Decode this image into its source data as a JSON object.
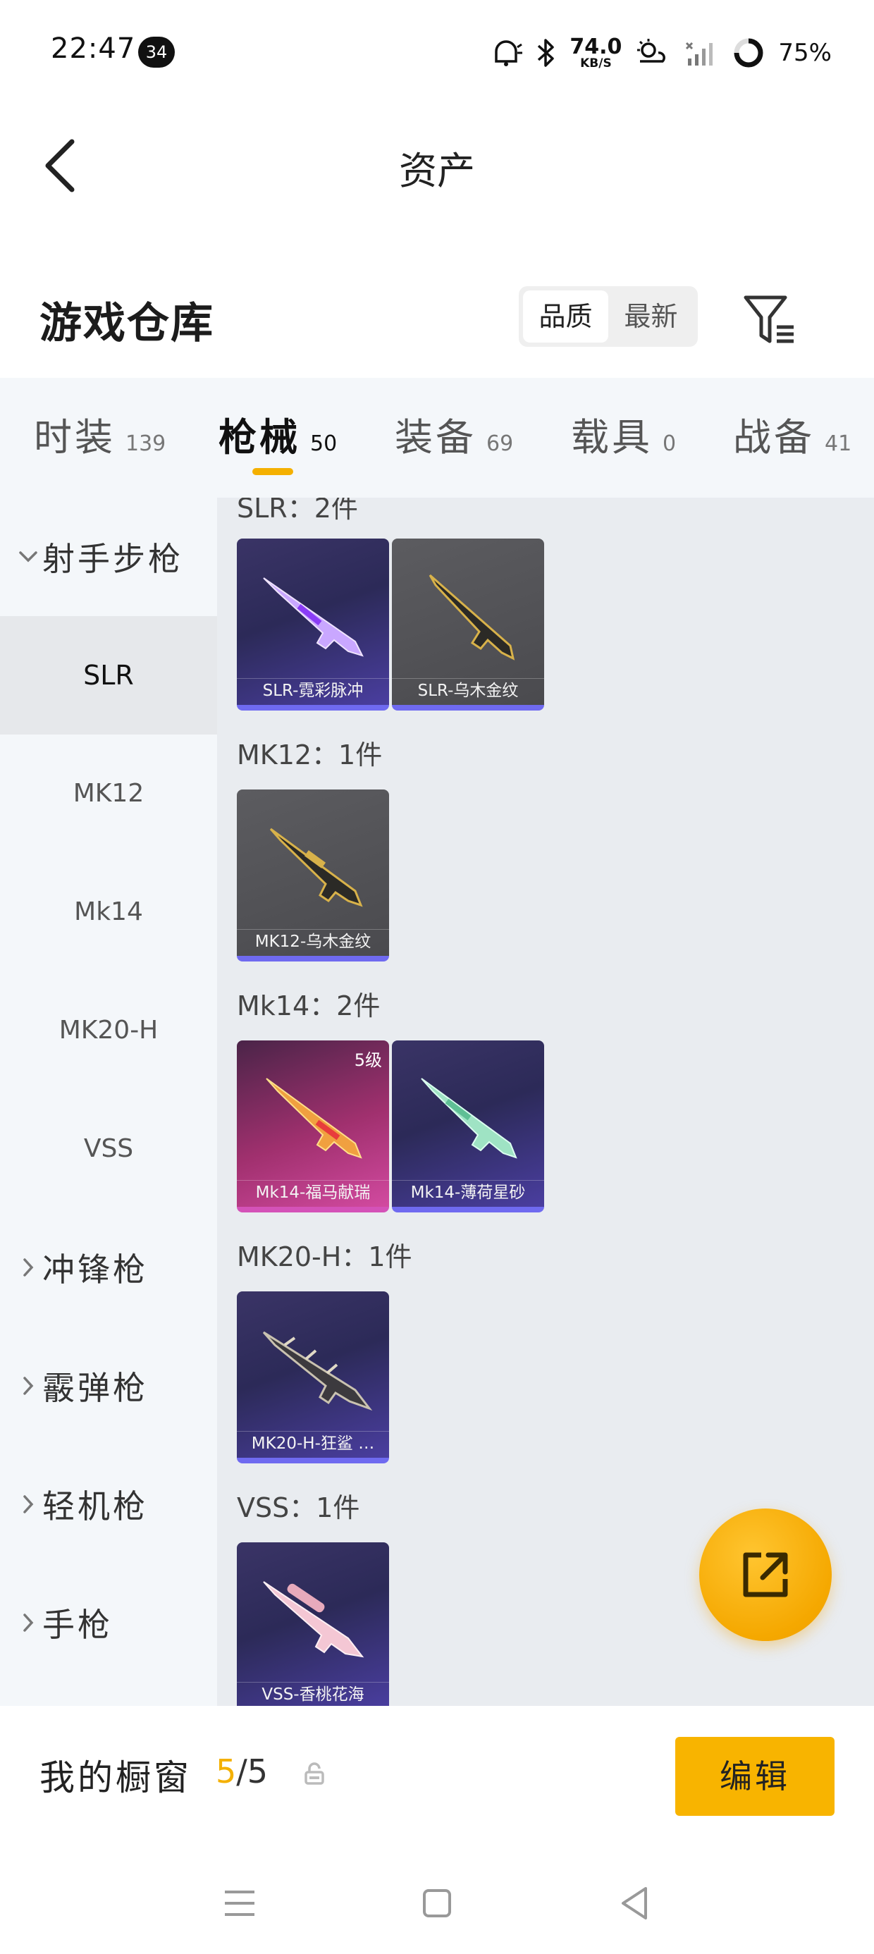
{
  "status_bar": {
    "time": "22:47",
    "notification_count": "34",
    "net_speed_value": "74.0",
    "net_speed_unit": "KB/S",
    "battery": "75%"
  },
  "header": {
    "title": "资产"
  },
  "warehouse": {
    "title": "游戏仓库",
    "sort_options": [
      "品质",
      "最新"
    ],
    "active_sort": "品质"
  },
  "tabs": [
    {
      "label": "时装",
      "count": "139"
    },
    {
      "label": "枪械",
      "count": "50"
    },
    {
      "label": "装备",
      "count": "69"
    },
    {
      "label": "载具",
      "count": "0"
    },
    {
      "label": "战备",
      "count": "41"
    }
  ],
  "active_tab": "枪械",
  "sidebar": {
    "expanded_category": "射手步枪",
    "subcategories": [
      "SLR",
      "MK12",
      "Mk14",
      "MK20-H",
      "VSS"
    ],
    "active_subcategory": "SLR",
    "collapsed_categories": [
      "冲锋枪",
      "霰弹枪",
      "轻机枪",
      "手枪"
    ]
  },
  "groups": [
    {
      "heading": "SLR：2件",
      "items": [
        {
          "name": "SLR-霓彩脉冲",
          "style": "purple",
          "level": ""
        },
        {
          "name": "SLR-乌木金纹",
          "style": "gray",
          "level": ""
        }
      ]
    },
    {
      "heading": "MK12：1件",
      "items": [
        {
          "name": "MK12-乌木金纹",
          "style": "gray",
          "level": ""
        }
      ]
    },
    {
      "heading": "Mk14：2件",
      "items": [
        {
          "name": "Mk14-福马献瑞",
          "style": "pink",
          "level": "5级"
        },
        {
          "name": "Mk14-薄荷星砂",
          "style": "purple",
          "level": ""
        }
      ]
    },
    {
      "heading": "MK20-H：1件",
      "items": [
        {
          "name": "MK20-H-狂鲨 …",
          "style": "purple",
          "level": ""
        }
      ]
    },
    {
      "heading": "VSS：1件",
      "items": [
        {
          "name": "VSS-香桃花海",
          "style": "purple",
          "level": ""
        }
      ]
    }
  ],
  "showcase": {
    "label": "我的橱窗",
    "current": "5",
    "total": "/5",
    "edit_label": "编辑"
  },
  "colors": {
    "accent": "#f8b400",
    "tab_bg": "#f4f7fa",
    "content_bg": "#e9ecf0",
    "rarity_purple": "#6f6af0",
    "rarity_pink": "#d452b8"
  },
  "icons": {
    "back": "back-arrow-icon",
    "filter": "filter-icon",
    "share": "share-external-icon",
    "lock": "lock-icon",
    "chevron_down": "chevron-down-icon",
    "chevron_right": "chevron-right-icon"
  }
}
